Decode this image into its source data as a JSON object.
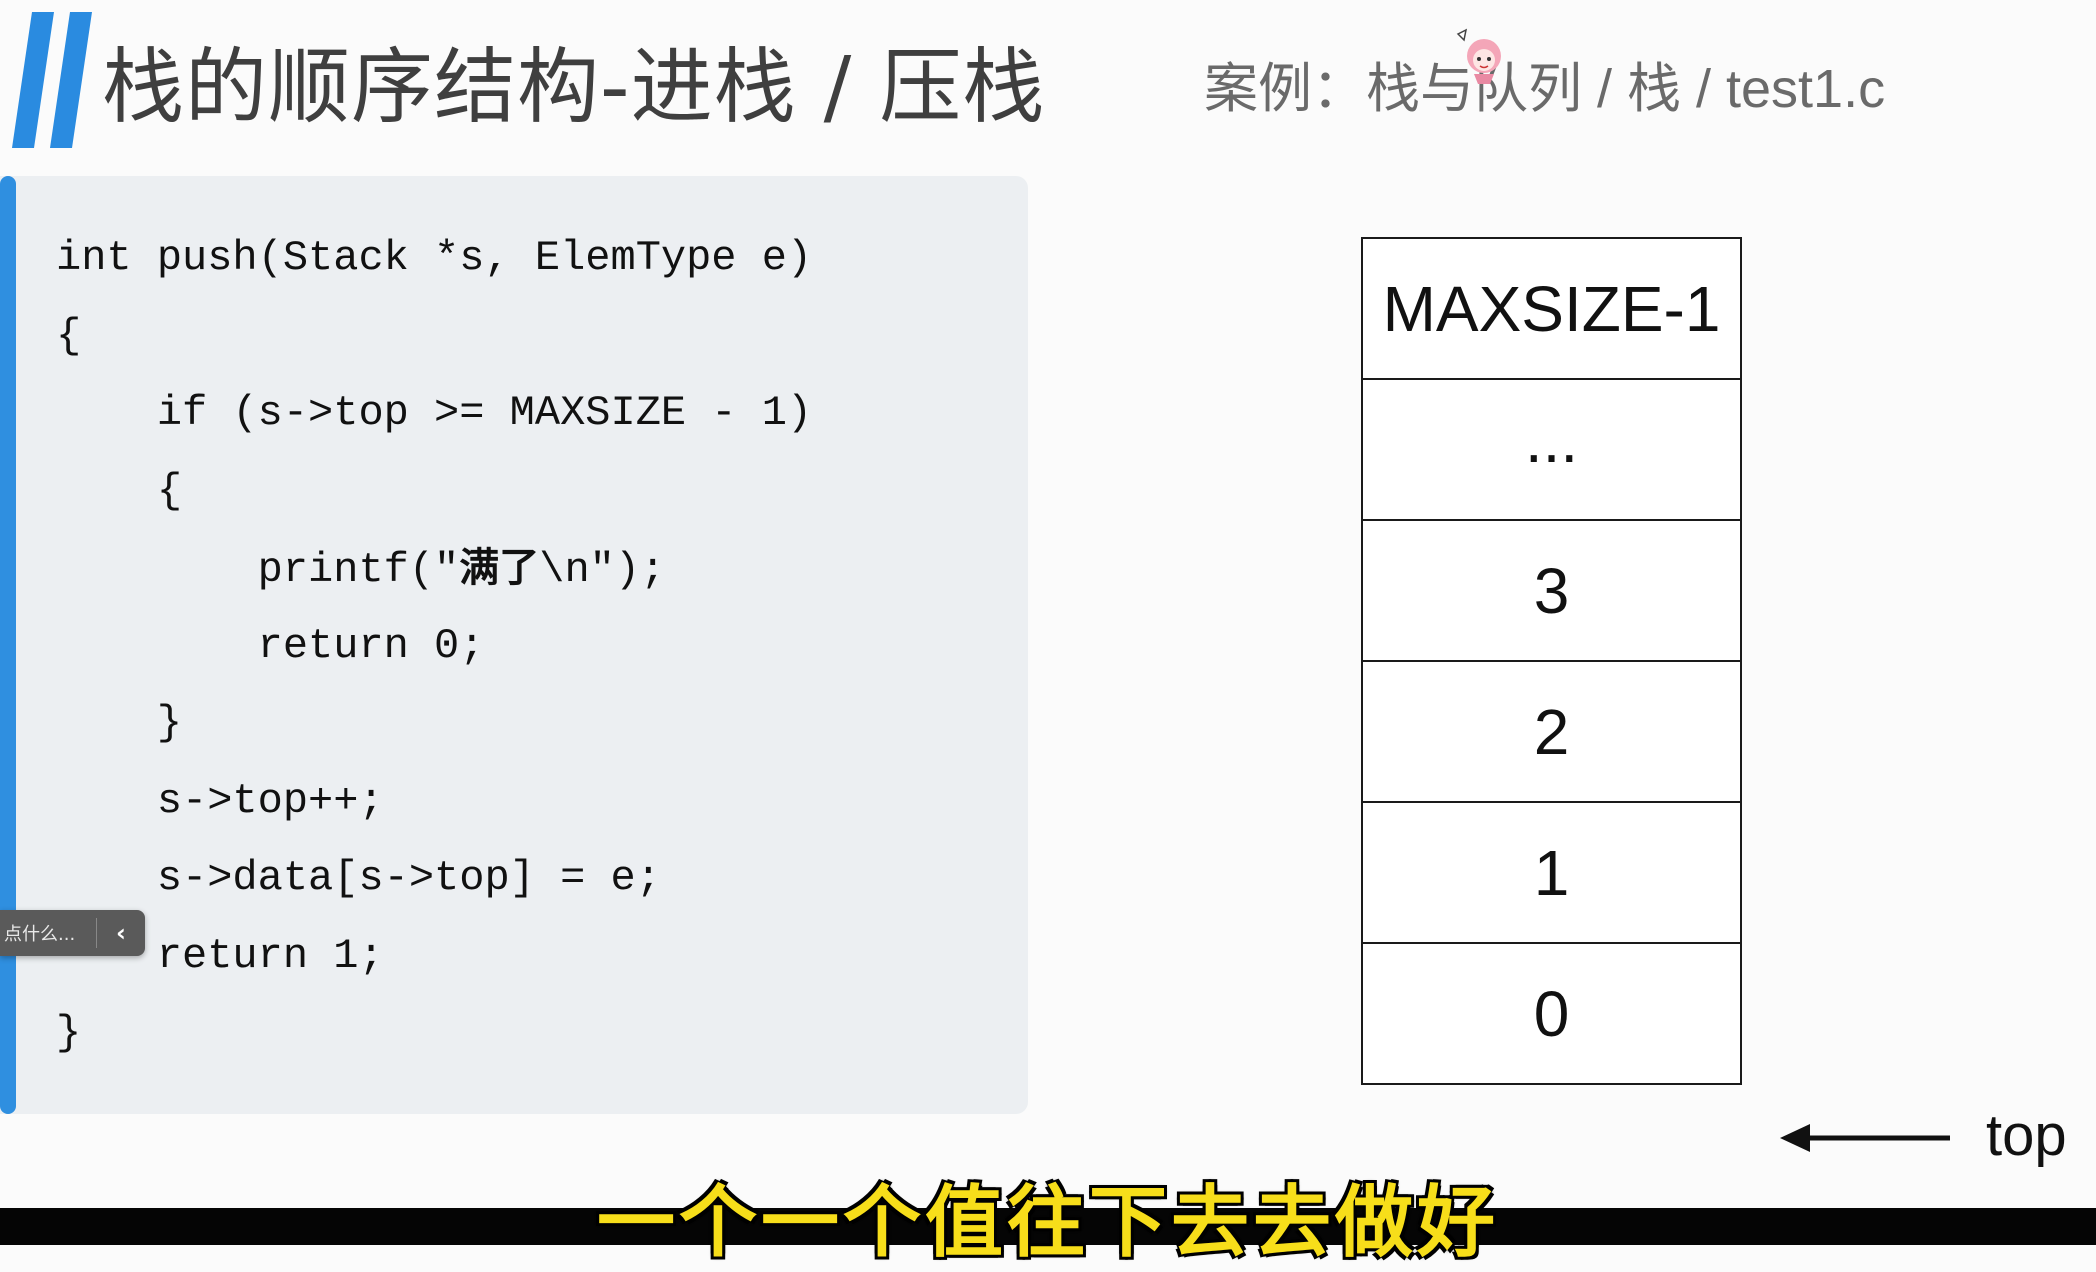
{
  "header": {
    "title": "栈的顺序结构-进栈 / 压栈",
    "case_label": "案例：栈与队列 / 栈 / test1.c"
  },
  "code": {
    "lines": [
      "int push(Stack *s, ElemType e)",
      "{",
      "    if (s->top >= MAXSIZE - 1)",
      "    {",
      "        printf(\"满了\\n\");",
      "        return 0;",
      "    }",
      "    s->top++;",
      "    s->data[s->top] = e;",
      "    return 1;",
      "}"
    ]
  },
  "stack_diagram": {
    "cells": [
      "MAXSIZE-1",
      "...",
      "3",
      "2",
      "1",
      "0"
    ],
    "pointer_label": "top"
  },
  "side_widget": {
    "text": "点什么...",
    "chevron": "‹"
  },
  "subtitle": "一个一个值往下去去做好",
  "colors": {
    "accent": "#2f8fe0",
    "subtitle": "#f7de1a"
  }
}
